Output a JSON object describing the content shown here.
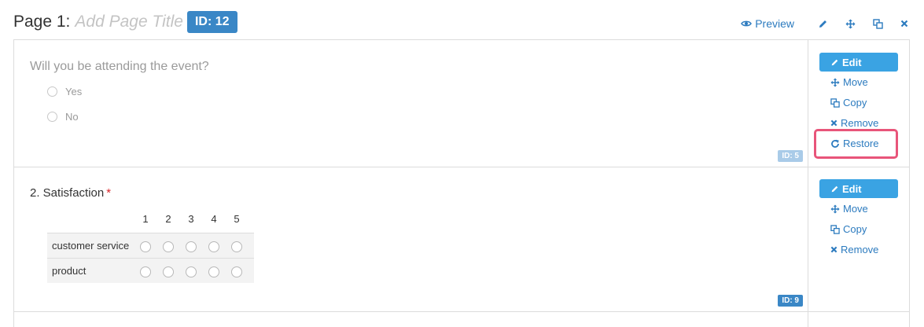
{
  "page": {
    "label": "Page 1:",
    "title_placeholder": "Add Page Title",
    "id_badge": "ID: 12"
  },
  "header_actions": {
    "preview_label": "Preview",
    "icons": [
      "pencil-icon",
      "move-icon",
      "copy-icon",
      "close-icon"
    ]
  },
  "questions": [
    {
      "title": "Will you be attending the event?",
      "options": [
        "Yes",
        "No"
      ],
      "id_badge": "ID: 5",
      "state": "removed",
      "actions": {
        "edit": "Edit",
        "move": "Move",
        "copy": "Copy",
        "remove": "Remove",
        "restore": "Restore"
      }
    },
    {
      "title": "2. Satisfaction",
      "required_mark": "*",
      "columns": [
        "1",
        "2",
        "3",
        "4",
        "5"
      ],
      "rows": [
        "customer service",
        "product"
      ],
      "id_badge": "ID: 9",
      "actions": {
        "edit": "Edit",
        "move": "Move",
        "copy": "Copy",
        "remove": "Remove"
      }
    }
  ],
  "colors": {
    "accent": "#3aa3e3",
    "link": "#2c7bbf",
    "badge": "#3a87c6",
    "highlight": "#e8557a",
    "required": "#d9252a"
  }
}
